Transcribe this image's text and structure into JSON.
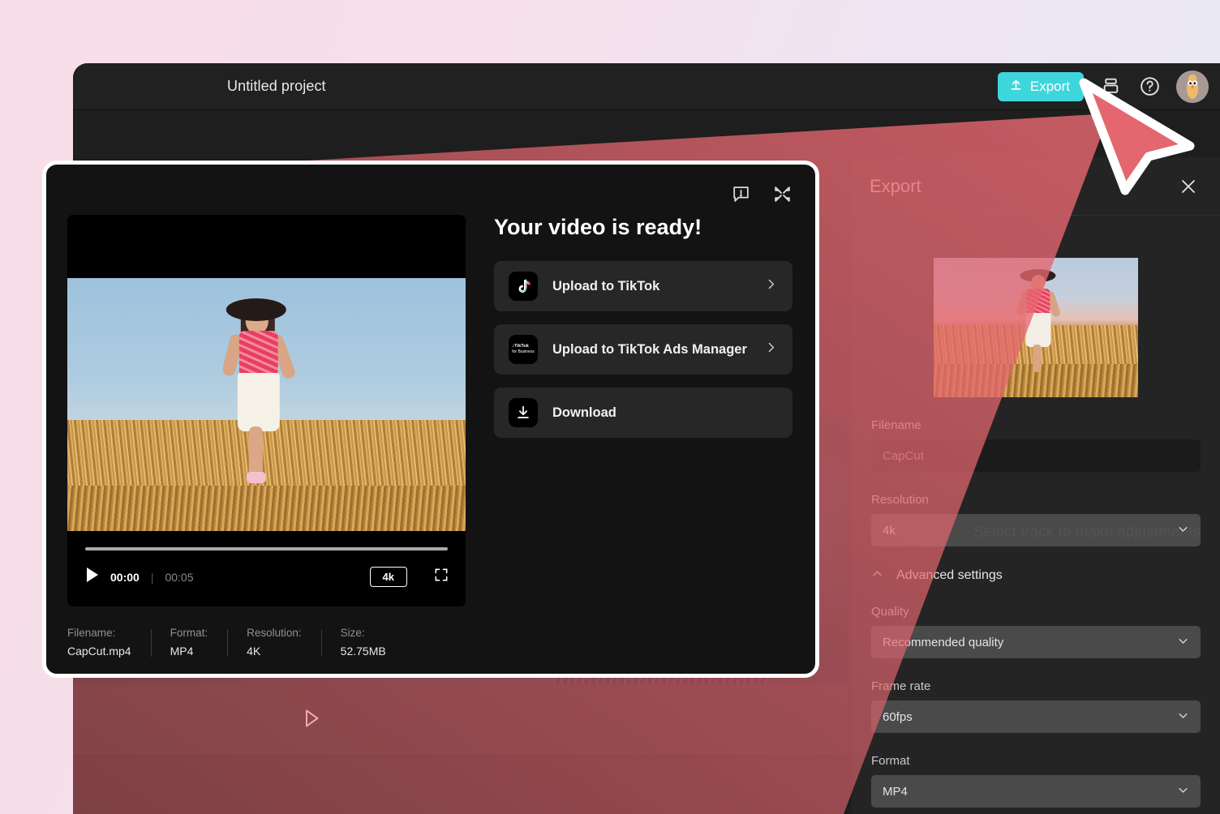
{
  "app": {
    "title": "Untitled project",
    "topbar": {
      "export_label": "Export",
      "export_color": "#3ed6dd",
      "icons": [
        "upload-icon",
        "layers-icon",
        "help-icon",
        "avatar"
      ]
    }
  },
  "export_panel": {
    "title": "Export",
    "close_label": "close-icon",
    "background_hint": "Select track to make adjustments",
    "fields": [
      {
        "label": "Filename",
        "value": "CapCut",
        "type": "input"
      },
      {
        "label": "Resolution",
        "value": "4k",
        "type": "select"
      },
      {
        "label": "Quality",
        "value": "Recommended quality",
        "type": "select"
      },
      {
        "label": "Frame rate",
        "value": "60fps",
        "type": "select"
      },
      {
        "label": "Format",
        "value": "MP4",
        "type": "select"
      }
    ],
    "advanced_settings_label": "Advanced settings",
    "advanced_expanded": true
  },
  "result_dialog": {
    "heading": "Your video is ready!",
    "tools": [
      "feedback-icon",
      "minimize-icon"
    ],
    "player": {
      "current_time": "00:00",
      "separator": "|",
      "total_time": "00:05",
      "quality_badge": "4k",
      "progress_percent": 0
    },
    "actions": [
      {
        "label": "Upload to TikTok",
        "icon": "tiktok-icon",
        "has_chevron": true
      },
      {
        "label": "Upload to TikTok Ads Manager",
        "icon": "tiktok-business-icon",
        "has_chevron": true
      },
      {
        "label": "Download",
        "icon": "download-icon",
        "has_chevron": false
      }
    ],
    "meta": [
      {
        "key": "Filename:",
        "value": "CapCut.mp4"
      },
      {
        "key": "Format:",
        "value": "MP4"
      },
      {
        "key": "Resolution:",
        "value": "4K"
      },
      {
        "key": "Size:",
        "value": "52.75MB"
      }
    ]
  },
  "annotation": {
    "cursor_color": "#e4666f",
    "beam_color": "#e4666f"
  }
}
